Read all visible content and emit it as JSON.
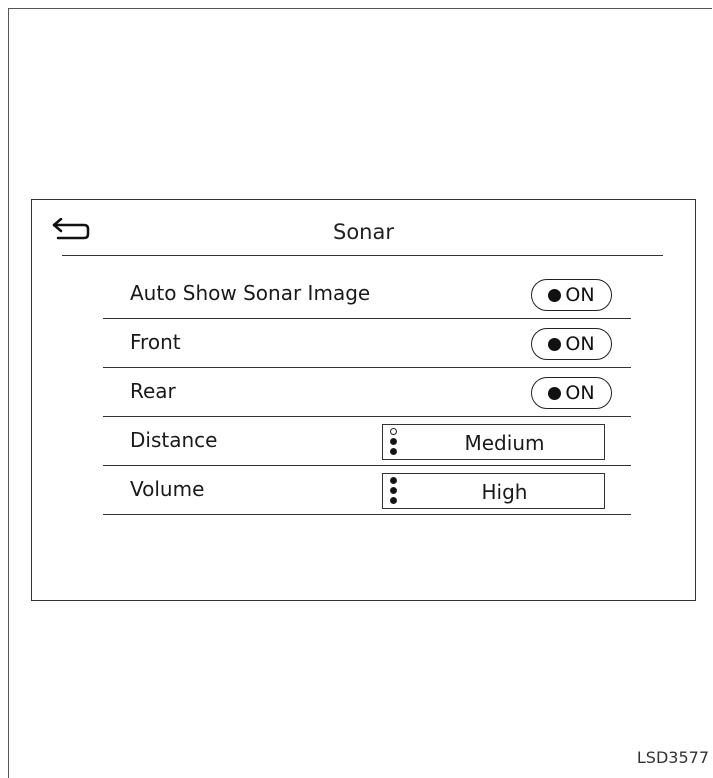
{
  "screen": {
    "title": "Sonar",
    "back_icon": "back-arrow-icon"
  },
  "settings": {
    "auto_show": {
      "label": "Auto Show Sonar Image",
      "value": "ON",
      "enabled": true
    },
    "front": {
      "label": "Front",
      "value": "ON",
      "enabled": true
    },
    "rear": {
      "label": "Rear",
      "value": "ON",
      "enabled": true
    },
    "distance": {
      "label": "Distance",
      "value": "Medium",
      "level": 2,
      "levels": 3
    },
    "volume": {
      "label": "Volume",
      "value": "High",
      "level": 3,
      "levels": 3
    }
  },
  "figure_code": "LSD3577"
}
